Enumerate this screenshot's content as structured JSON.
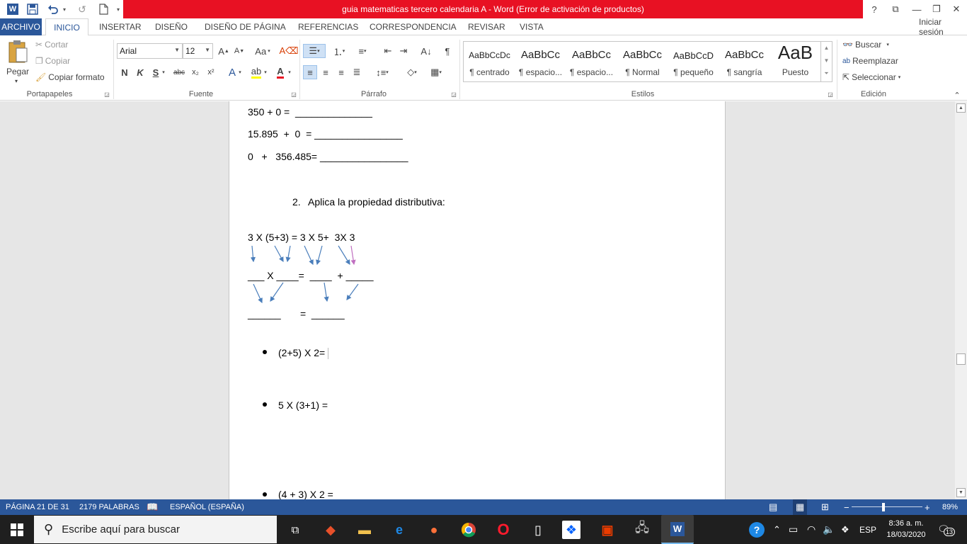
{
  "window": {
    "title": "guia matematicas tercero calendaria A -  Word (Error de activación de productos)",
    "help": "?",
    "restore_ribbon": "⧉",
    "minimize": "—",
    "restore": "❐",
    "close": "✕"
  },
  "quick_access": {
    "word_icon": "W",
    "save_icon": "save-icon",
    "undo_icon": "undo-icon",
    "redo_icon": "redo-icon",
    "new_icon": "new-document-icon"
  },
  "tabs": [
    "ARCHIVO",
    "INICIO",
    "INSERTAR",
    "DISEÑO",
    "DISEÑO DE PÁGINA",
    "REFERENCIAS",
    "CORRESPONDENCIA",
    "REVISAR",
    "VISTA"
  ],
  "signin": "Iniciar sesión",
  "ribbon": {
    "clipboard": {
      "paste": "Pegar",
      "cut": "Cortar",
      "copy": "Copiar",
      "format_painter": "Copiar formato",
      "label": "Portapapeles"
    },
    "font": {
      "name": "Arial",
      "size": "12",
      "bold": "N",
      "italic": "K",
      "underline": "S",
      "strike": "abc",
      "subscript": "x₂",
      "superscript": "x²",
      "grow": "A^",
      "shrink": "Aˇ",
      "case": "Aa",
      "label": "Fuente"
    },
    "paragraph": {
      "label": "Párrafo",
      "pilcrow": "¶"
    },
    "styles": {
      "label": "Estilos",
      "items": [
        {
          "preview": "AaBbCcDc",
          "name": "¶ centrado"
        },
        {
          "preview": "AaBbCc",
          "name": "¶ espacio..."
        },
        {
          "preview": "AaBbCc",
          "name": "¶ espacio..."
        },
        {
          "preview": "AaBbCc",
          "name": "¶ Normal"
        },
        {
          "preview": "AaBbCcD",
          "name": "¶ pequeño"
        },
        {
          "preview": "AaBbCc",
          "name": "¶ sangría"
        },
        {
          "preview": "AaB",
          "name": "Puesto"
        }
      ]
    },
    "editing": {
      "find": "Buscar",
      "replace": "Reemplazar",
      "select": "Seleccionar",
      "label": "Edición"
    }
  },
  "document": {
    "lines": [
      "350 + 0 =  ______________",
      "15.895  +  0  = ________________",
      "0   +   356.485= ________________",
      "2.",
      "Aplica la propiedad distributiva:",
      "3 X (5+3) = 3 X 5+  3X 3",
      "___ X ____=  ____  + _____",
      "______       =  ______",
      "(2+5) X 2=",
      "5 X (3+1) =",
      "(4 + 3) X 2 ="
    ]
  },
  "status": {
    "page": "PÁGINA 21 DE 31",
    "words": "2179 PALABRAS",
    "language": "ESPAÑOL (ESPAÑA)",
    "zoom": "89%",
    "zoom_level": 0.89
  },
  "taskbar": {
    "search_placeholder": "Escribe aquí para buscar",
    "lang": "ESP",
    "time": "8:36 a. m.",
    "date": "18/03/2020",
    "notifications": "13"
  }
}
